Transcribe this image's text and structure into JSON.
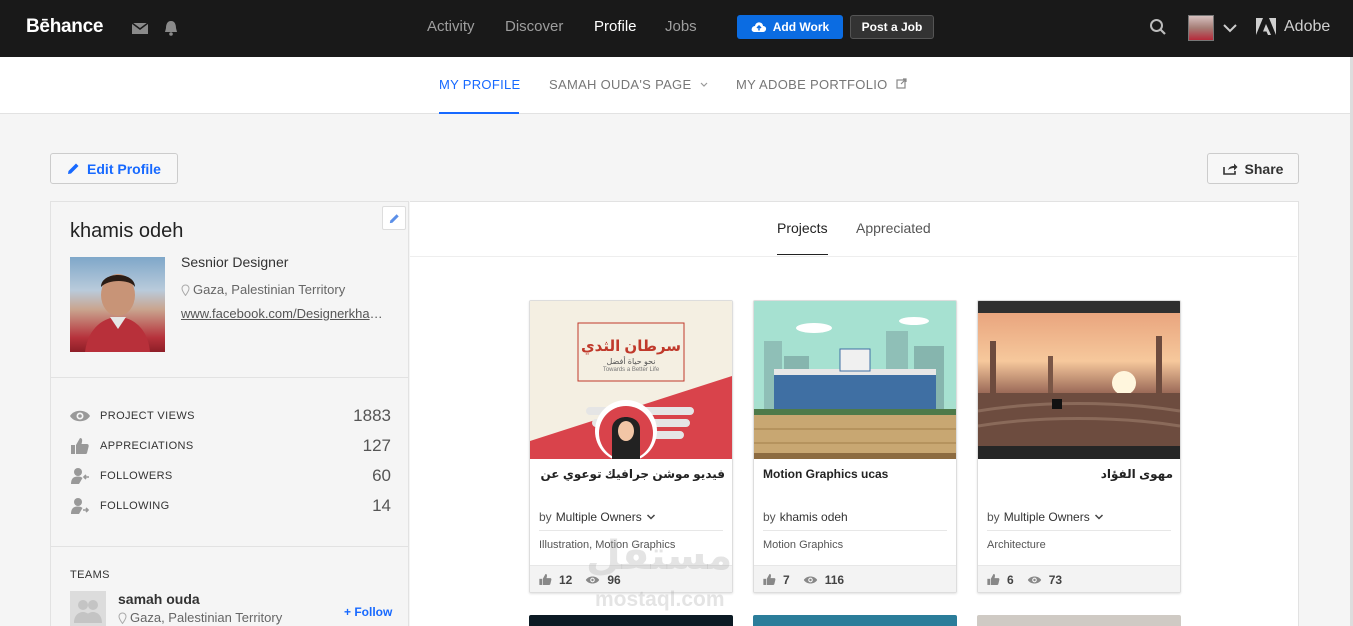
{
  "topbar": {
    "logo": "Bēhance",
    "nav": [
      "Activity",
      "Discover",
      "Profile",
      "Jobs"
    ],
    "active_nav": "Profile",
    "add_work": "Add Work",
    "post_job": "Post a Job",
    "adobe": "Adobe"
  },
  "subnav": {
    "tabs": [
      "MY PROFILE",
      "SAMAH OUDA'S PAGE",
      "MY ADOBE PORTFOLIO"
    ],
    "active": "MY PROFILE"
  },
  "actions": {
    "edit_profile": "Edit Profile",
    "share": "Share"
  },
  "profile": {
    "name": "khamis odeh",
    "title": "Sesnior Designer",
    "location": "Gaza, Palestinian Territory",
    "website": "www.facebook.com/Designerkhamisodeh"
  },
  "stats": [
    {
      "label": "PROJECT VIEWS",
      "value": "1883",
      "icon": "eye-icon"
    },
    {
      "label": "APPRECIATIONS",
      "value": "127",
      "icon": "thumbs-up-icon"
    },
    {
      "label": "FOLLOWERS",
      "value": "60",
      "icon": "follower-icon"
    },
    {
      "label": "FOLLOWING",
      "value": "14",
      "icon": "following-icon"
    }
  ],
  "teams": {
    "heading": "TEAMS",
    "name": "samah ouda",
    "location": "Gaza, Palestinian Territory",
    "follow": "+ Follow"
  },
  "content_tabs": [
    "Projects",
    "Appreciated"
  ],
  "active_content_tab": "Projects",
  "projects": [
    {
      "title": "فيديو موشن جرافيك توعوي عن سرطان الثدي",
      "by": "by",
      "owner": "Multiple Owners",
      "fields": "Illustration, Motion Graphics",
      "likes": "12",
      "views": "96",
      "thumb_heading": "سرطان الثدي",
      "thumb_sub": "نحو حياة أفضل",
      "thumb_en": "Towards a Better Life"
    },
    {
      "title": "Motion Graphics ucas",
      "by": "by",
      "owner": "khamis odeh",
      "fields": "Motion Graphics",
      "likes": "7",
      "views": "116"
    },
    {
      "title": "مهوى الفؤاد",
      "by": "by",
      "owner": "Multiple Owners",
      "fields": "Architecture",
      "likes": "6",
      "views": "73"
    }
  ],
  "watermark": {
    "arabic": "مستقل",
    "latin": "mostaql.com"
  },
  "colors": {
    "accent": "#1769ff",
    "topbar": "#191919",
    "add_work": "#0b6ce2"
  }
}
